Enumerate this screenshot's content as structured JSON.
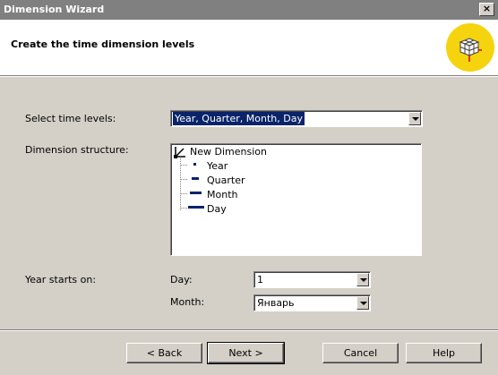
{
  "window": {
    "title": "Dimension Wizard",
    "close_glyph": "×"
  },
  "header": {
    "title": "Create the time dimension levels",
    "icon": "cube-icon"
  },
  "time_levels": {
    "label": "Select time levels:",
    "value": "Year, Quarter, Month, Day"
  },
  "structure": {
    "label": "Dimension structure:",
    "root": "New Dimension",
    "levels": [
      "Year",
      "Quarter",
      "Month",
      "Day"
    ]
  },
  "year_start": {
    "label": "Year starts on:",
    "day_label": "Day:",
    "day_value": "1",
    "month_label": "Month:",
    "month_value": "Январь"
  },
  "buttons": {
    "back": "< Back",
    "next": "Next >",
    "cancel": "Cancel",
    "help": "Help"
  },
  "colors": {
    "selection": "#0a246a",
    "icon_bg": "#f6d30f"
  }
}
